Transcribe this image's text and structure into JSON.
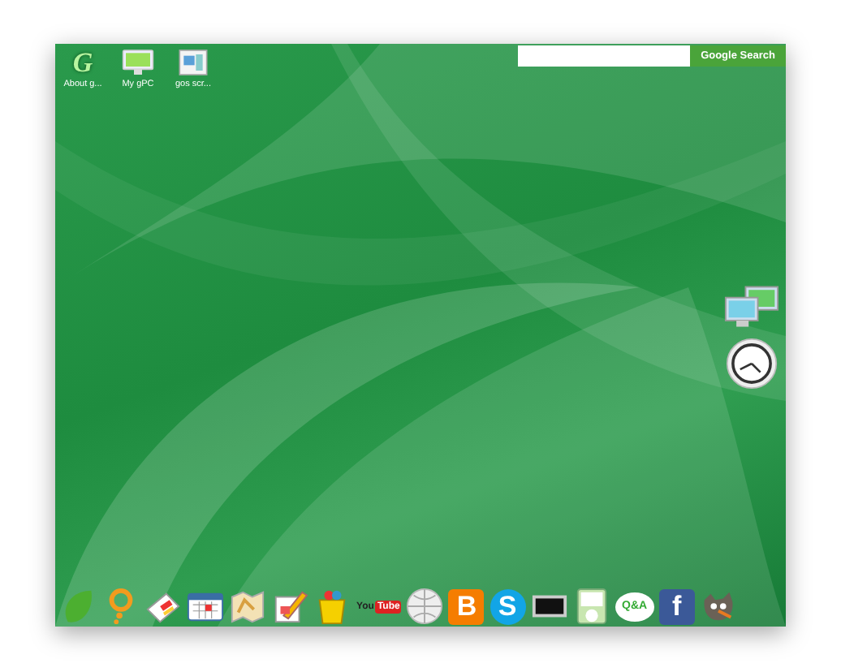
{
  "desktop_icons": [
    {
      "kind": "g-logo",
      "glyph": "G",
      "label": "About g..."
    },
    {
      "kind": "monitor",
      "label": "My gPC"
    },
    {
      "kind": "screenshot",
      "label": "gos scr..."
    }
  ],
  "search": {
    "button": "Google Search"
  },
  "widgets": [
    {
      "kind": "monitors"
    },
    {
      "kind": "clock"
    }
  ],
  "dock": [
    {
      "kind": "leaf"
    },
    {
      "kind": "pin"
    },
    {
      "kind": "newspaper"
    },
    {
      "kind": "calendar"
    },
    {
      "kind": "map"
    },
    {
      "kind": "pencil"
    },
    {
      "kind": "bag"
    },
    {
      "kind": "youtube",
      "text": "You",
      "badge": "Tube"
    },
    {
      "kind": "globe"
    },
    {
      "kind": "letter",
      "glyph": "B",
      "color": "#f57d00"
    },
    {
      "kind": "letter",
      "glyph": "S",
      "color": "#12a5e6"
    },
    {
      "kind": "screen"
    },
    {
      "kind": "player"
    },
    {
      "kind": "bubble",
      "glyph": "Q&A"
    },
    {
      "kind": "letter",
      "glyph": "f",
      "color": "#3b5998"
    },
    {
      "kind": "mascot"
    }
  ]
}
